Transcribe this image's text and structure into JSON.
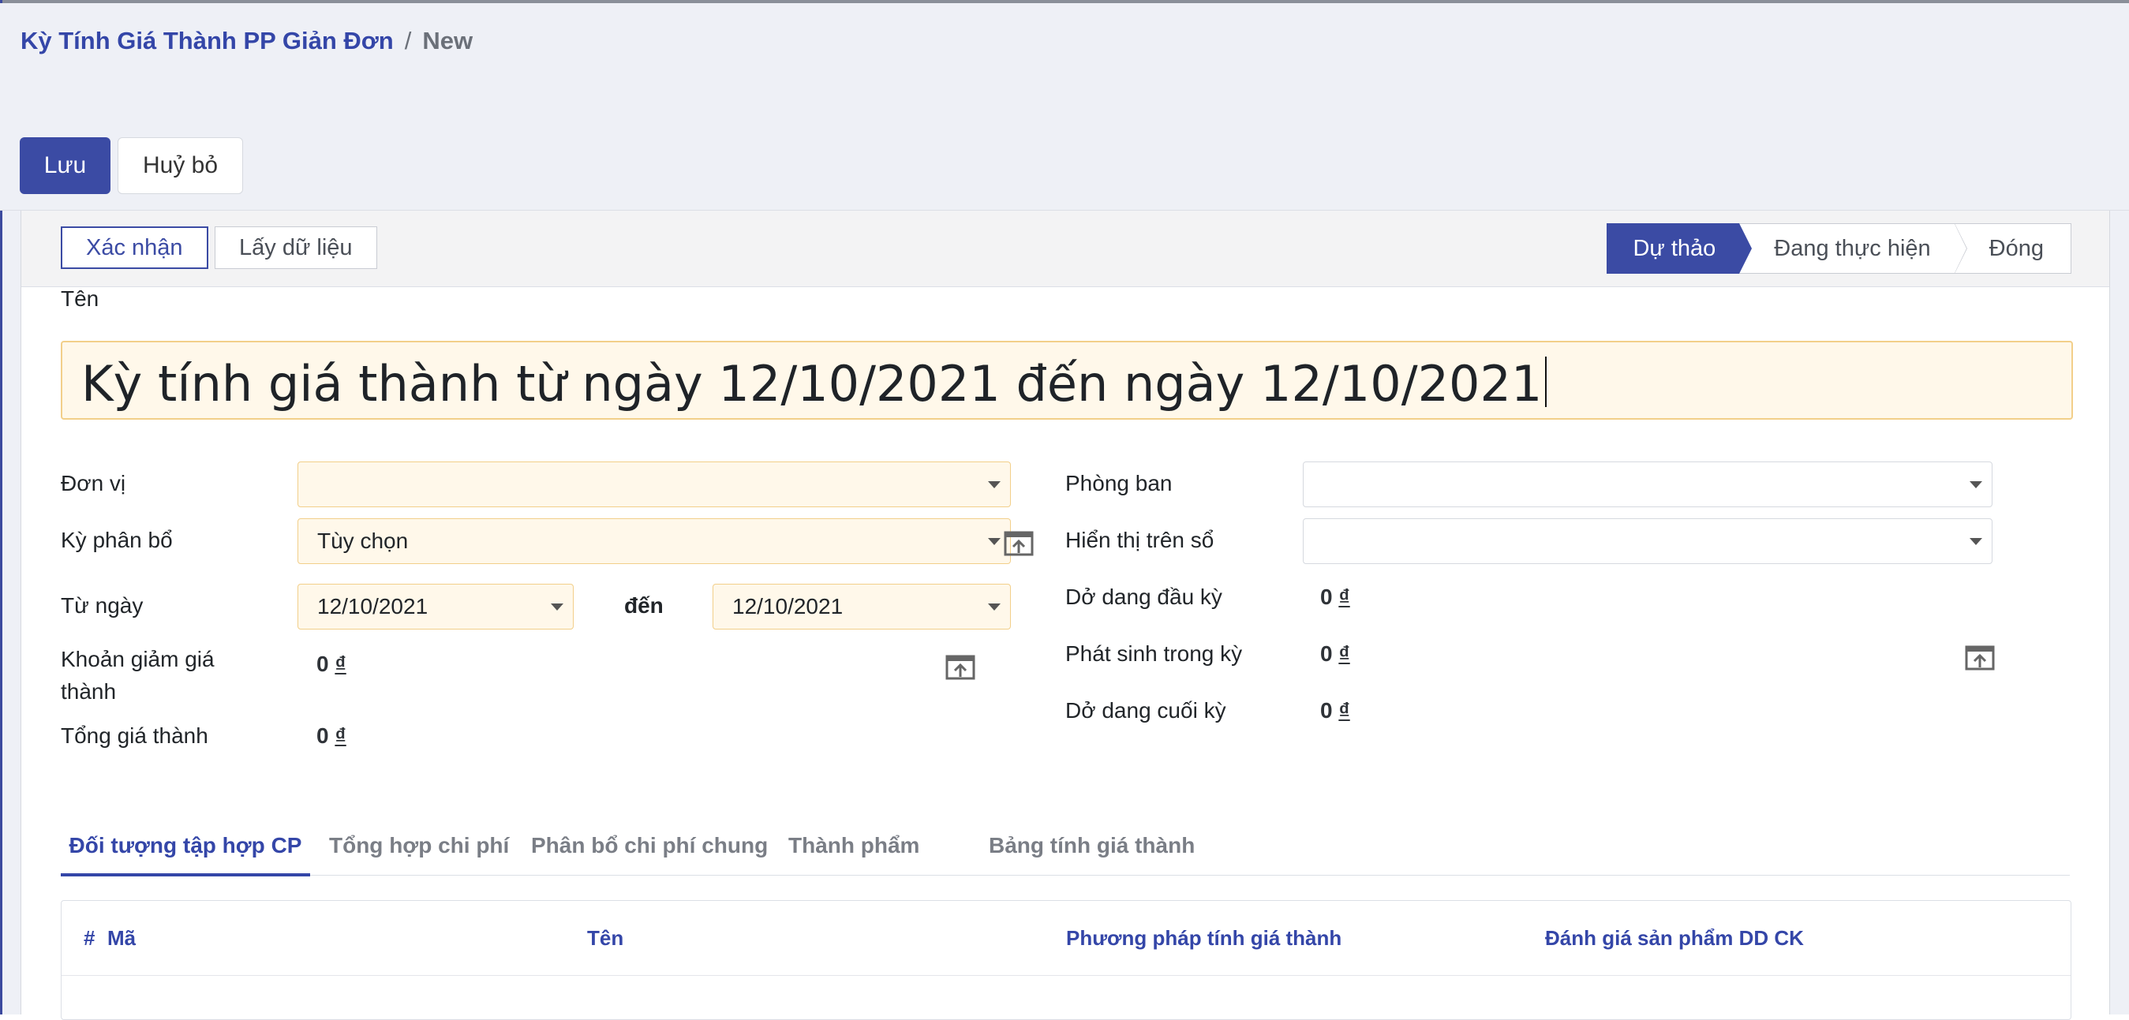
{
  "breadcrumb": {
    "parent": "Kỳ Tính Giá Thành PP Giản Đơn",
    "separator": "/",
    "current": "New"
  },
  "toolbar": {
    "save_label": "Lưu",
    "discard_label": "Huỷ bỏ"
  },
  "statusbar": {
    "confirm_label": "Xác nhận",
    "fetch_label": "Lấy dữ liệu",
    "steps": [
      "Dự thảo",
      "Đang thực hiện",
      "Đóng"
    ],
    "active_step": "Dự thảo"
  },
  "form": {
    "name_label": "Tên",
    "name_value": "Kỳ tính giá thành từ ngày 12/10/2021 đến ngày 12/10/2021",
    "left": {
      "unit_label": "Đơn vị",
      "unit_value": "",
      "period_label": "Kỳ phân bổ",
      "period_value": "Tùy chọn",
      "from_label": "Từ ngày",
      "from_value": "12/10/2021",
      "to_label": "đến",
      "to_value": "12/10/2021",
      "reduction_label_line1": "Khoản giảm giá",
      "reduction_label_line2": "thành",
      "reduction_amount": "0",
      "reduction_currency": "₫",
      "total_label": "Tổng giá thành",
      "total_amount": "0",
      "total_currency": "₫"
    },
    "right": {
      "dept_label": "Phòng ban",
      "dept_value": "",
      "display_label": "Hiển thị trên sổ",
      "display_value": "",
      "wip_begin_label": "Dở dang đầu kỳ",
      "wip_begin_amount": "0",
      "wip_begin_currency": "₫",
      "incurred_label": "Phát sinh trong kỳ",
      "incurred_amount": "0",
      "incurred_currency": "₫",
      "wip_end_label": "Dở dang cuối kỳ",
      "wip_end_amount": "0",
      "wip_end_currency": "₫"
    }
  },
  "tabs": [
    "Đối tượng tập hợp CP",
    "Tổng hợp chi phí",
    "Phân bổ chi phí chung",
    "Thành phẩm",
    "Bảng tính giá thành"
  ],
  "table": {
    "columns": [
      "#",
      "Mã",
      "Tên",
      "Phương pháp tính giá thành",
      "Đánh giá sản phẩm DD CK"
    ]
  },
  "colors": {
    "primary": "#3b4ba4",
    "required_bg": "#fff8ea",
    "required_border": "#f2cf8a",
    "link": "#3446a8"
  },
  "icons": {
    "dropdown": "caret-down-icon",
    "external": "open-external-icon"
  }
}
